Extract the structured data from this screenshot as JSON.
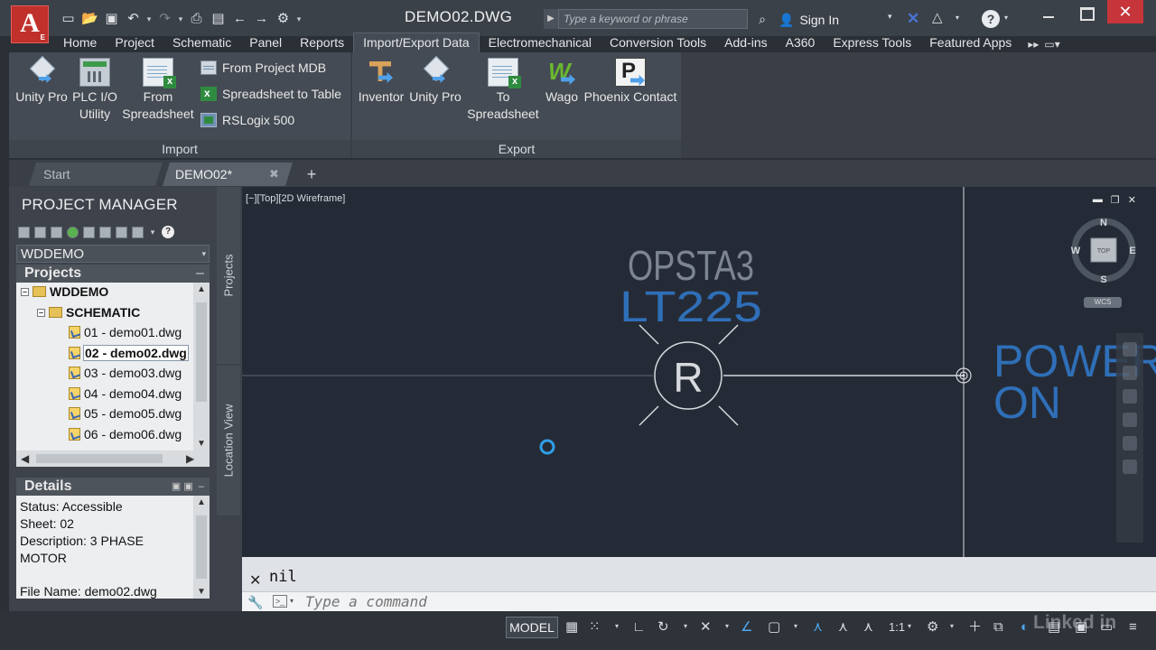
{
  "title_bar": {
    "logo_letter": "A",
    "logo_sub": "E",
    "document_title": "DEMO02.DWG",
    "search_placeholder": "Type a keyword or phrase",
    "sign_in_label": "Sign In"
  },
  "ribbon_tabs": [
    {
      "label": "Home"
    },
    {
      "label": "Project"
    },
    {
      "label": "Schematic"
    },
    {
      "label": "Panel"
    },
    {
      "label": "Reports"
    },
    {
      "label": "Import/Export Data",
      "active": true
    },
    {
      "label": "Electromechanical"
    },
    {
      "label": "Conversion Tools"
    },
    {
      "label": "Add-ins"
    },
    {
      "label": "A360"
    },
    {
      "label": "Express Tools"
    },
    {
      "label": "Featured Apps"
    }
  ],
  "ribbon": {
    "import_title": "Import",
    "export_title": "Export",
    "import_buttons": [
      {
        "line1": "Unity Pro",
        "line2": ""
      },
      {
        "line1": "PLC I/O",
        "line2": "Utility"
      },
      {
        "line1": "From",
        "line2": "Spreadsheet"
      }
    ],
    "import_small": [
      {
        "label": "From Project MDB"
      },
      {
        "label": "Spreadsheet to Table"
      },
      {
        "label": "RSLogix 500"
      }
    ],
    "export_buttons": [
      {
        "line1": "Inventor",
        "line2": ""
      },
      {
        "line1": "Unity Pro",
        "line2": ""
      },
      {
        "line1": "To",
        "line2": "Spreadsheet"
      },
      {
        "line1": "Wago",
        "line2": ""
      },
      {
        "line1": "Phoenix Contact",
        "line2": ""
      }
    ]
  },
  "doc_tabs": {
    "start": "Start",
    "current": "DEMO02*"
  },
  "project_manager": {
    "title": "PROJECT MANAGER",
    "selected_project": "WDDEMO",
    "projects_header": "Projects",
    "tree": {
      "root": "WDDEMO",
      "folder": "SCHEMATIC",
      "files": [
        "01 - demo01.dwg",
        "02 - demo02.dwg",
        "03 - demo03.dwg",
        "04 - demo04.dwg",
        "05 - demo05.dwg",
        "06 - demo06.dwg"
      ],
      "selected_index": 1
    },
    "details_header": "Details",
    "details": {
      "status": "Status: Accessible",
      "sheet": "Sheet: 02",
      "description": "Description: 3 PHASE MOTOR",
      "file_name": "File Name: demo02.dwg"
    },
    "side_tabs": [
      "Projects",
      "Location View"
    ]
  },
  "canvas": {
    "viewport_label": "[−][Top][2D Wireframe]",
    "tag_line1": "OPSTA3",
    "tag_line2": "LT225",
    "symbol_letter": "R",
    "side_text_line1": "POWER",
    "side_text_line2": "ON",
    "viewcube": {
      "n": "N",
      "s": "S",
      "e": "E",
      "w": "W",
      "top": "TOP",
      "wcs": "WCS"
    },
    "colors": {
      "background": "#252b36",
      "tag_gray": "#7d8591",
      "tag_blue": "#2f6fb8",
      "symbol": "#d6d9dd"
    }
  },
  "command_line": {
    "last_output": "nil",
    "placeholder": "Type a command"
  },
  "status_bar": {
    "model_label": "MODEL",
    "scale_label": "1:1"
  },
  "watermark": "Linked in"
}
